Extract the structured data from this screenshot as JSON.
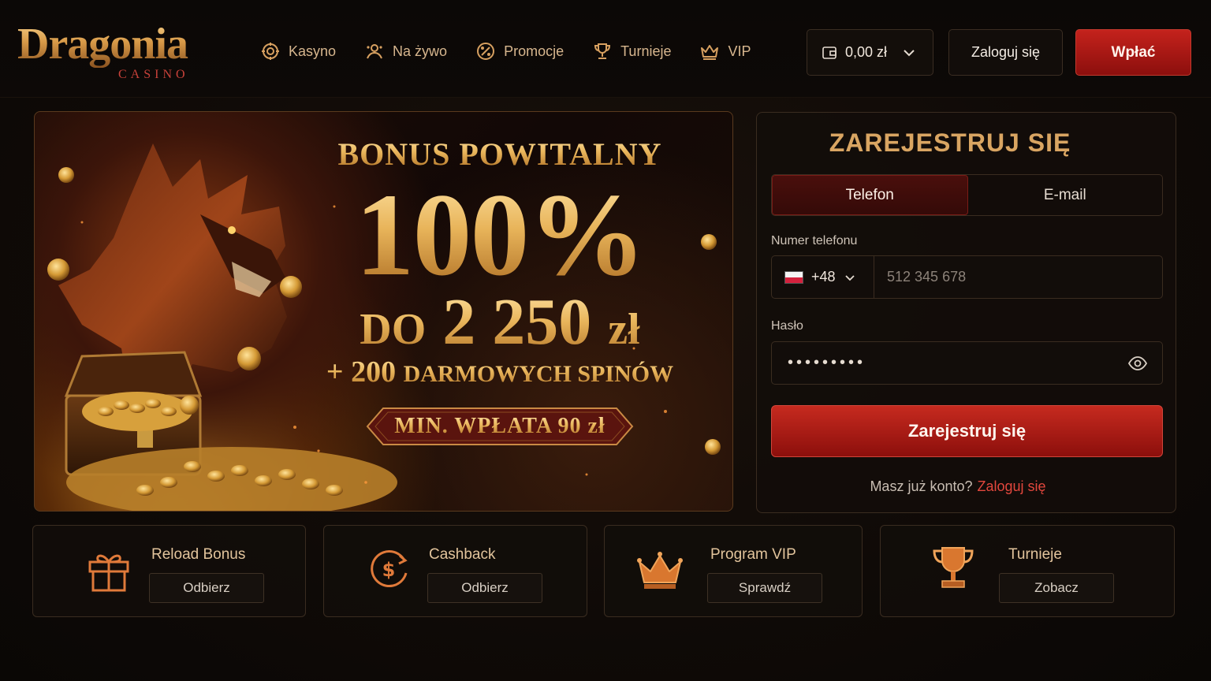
{
  "brand": {
    "name": "Dragonia",
    "subtitle": "CASINO"
  },
  "nav": [
    {
      "label": "Kasyno",
      "icon": "chip-icon"
    },
    {
      "label": "Na żywo",
      "icon": "live-dealer-icon"
    },
    {
      "label": "Promocje",
      "icon": "promo-icon"
    },
    {
      "label": "Turnieje",
      "icon": "trophy-icon"
    },
    {
      "label": "VIP",
      "icon": "crown-icon"
    }
  ],
  "header": {
    "balance": "0,00 zł",
    "login_label": "Zaloguj się",
    "deposit_label": "Wpłać"
  },
  "hero": {
    "headline": "BONUS POWITALNY",
    "percent": "100%",
    "amount_prefix": "DO",
    "amount_value": "2 250",
    "amount_currency": "zł",
    "spins_count": "+ 200",
    "spins_label": "DARMOWYCH SPINÓW",
    "min_deposit": "MIN. WPŁATA 90 zł"
  },
  "register": {
    "title": "ZAREJESTRUJ SIĘ",
    "tabs": [
      {
        "label": "Telefon",
        "active": true
      },
      {
        "label": "E-mail",
        "active": false
      }
    ],
    "phone_label": "Numer telefonu",
    "country_code": "+48",
    "phone_placeholder": "512 345 678",
    "password_label": "Hasło",
    "password_value": "•••••••••",
    "submit_label": "Zarejestruj się",
    "have_account": "Masz już konto?",
    "login_link": "Zaloguj się"
  },
  "promos": [
    {
      "title": "Reload Bonus",
      "button": "Odbierz",
      "icon": "gift-icon"
    },
    {
      "title": "Cashback",
      "button": "Odbierz",
      "icon": "cashback-icon"
    },
    {
      "title": "Program VIP",
      "button": "Sprawdź",
      "icon": "crown-icon"
    },
    {
      "title": "Turnieje",
      "button": "Zobacz",
      "icon": "trophy-icon"
    }
  ],
  "colors": {
    "accent_red": "#c4221c",
    "gold": "#d9a562",
    "background": "#0f0a07"
  }
}
